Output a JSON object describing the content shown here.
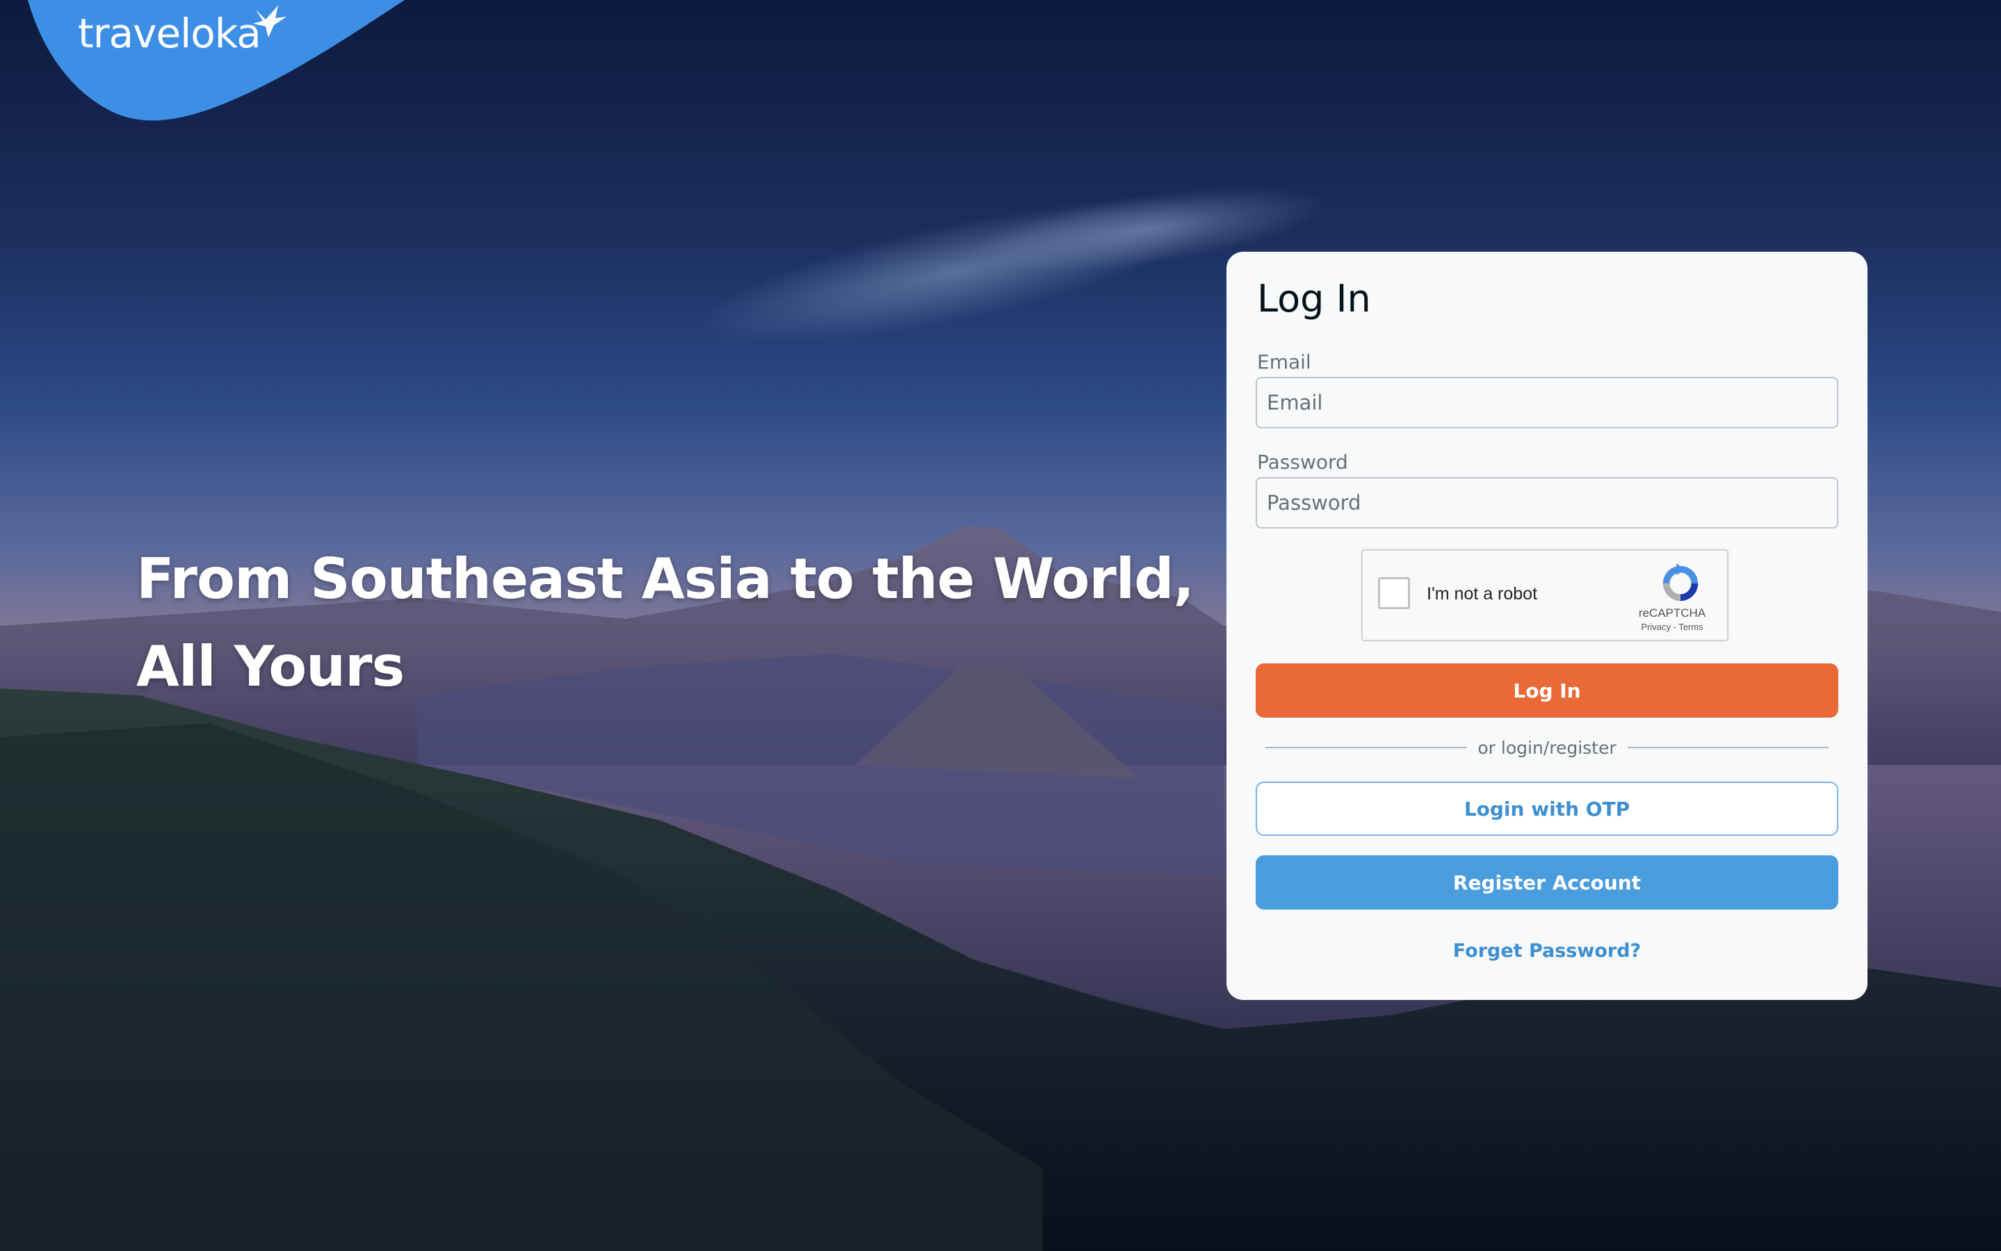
{
  "brand": {
    "name": "traveloka",
    "accent_color": "#4a9ddc"
  },
  "hero": {
    "headline": "From Southeast Asia to the World, All Yours"
  },
  "login": {
    "title": "Log In",
    "email": {
      "label": "Email",
      "placeholder": "Email",
      "value": ""
    },
    "password": {
      "label": "Password",
      "placeholder": "Password",
      "value": ""
    },
    "captcha": {
      "label": "I'm not a robot",
      "brand": "reCAPTCHA",
      "links": "Privacy - Terms",
      "checked": false
    },
    "login_button": "Log In",
    "divider_text": "or login/register",
    "otp_button": "Login with OTP",
    "register_button": "Register Account",
    "forget_link": "Forget Password?",
    "colors": {
      "login_button": "#e96a36",
      "register_button": "#4a9ddc",
      "otp_text": "#3d8fd1"
    }
  }
}
